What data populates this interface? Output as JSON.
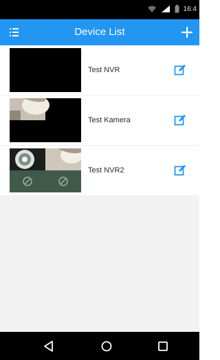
{
  "status_bar": {
    "time": "16:4",
    "icons": [
      "wifi-icon",
      "signal-icon",
      "battery-icon"
    ]
  },
  "app_bar": {
    "title": "Device List",
    "menu_icon": "menu-icon",
    "add_icon": "add-icon"
  },
  "devices": [
    {
      "name": "Test NVR",
      "thumbnail": "black-screen",
      "edit_icon": "edit-icon"
    },
    {
      "name": "Test Kamera",
      "thumbnail": "camera-snapshot",
      "edit_icon": "edit-icon"
    },
    {
      "name": "Test NVR2",
      "thumbnail": "multi-channel-grid",
      "edit_icon": "edit-icon"
    }
  ],
  "nav_bar": {
    "buttons": [
      "back-icon",
      "home-icon",
      "recent-apps-icon"
    ]
  },
  "colors": {
    "accent": "#2196f3",
    "edit_icon": "#2196f3",
    "nav_bar": "#000000",
    "background_empty": "#f2f2f2"
  }
}
